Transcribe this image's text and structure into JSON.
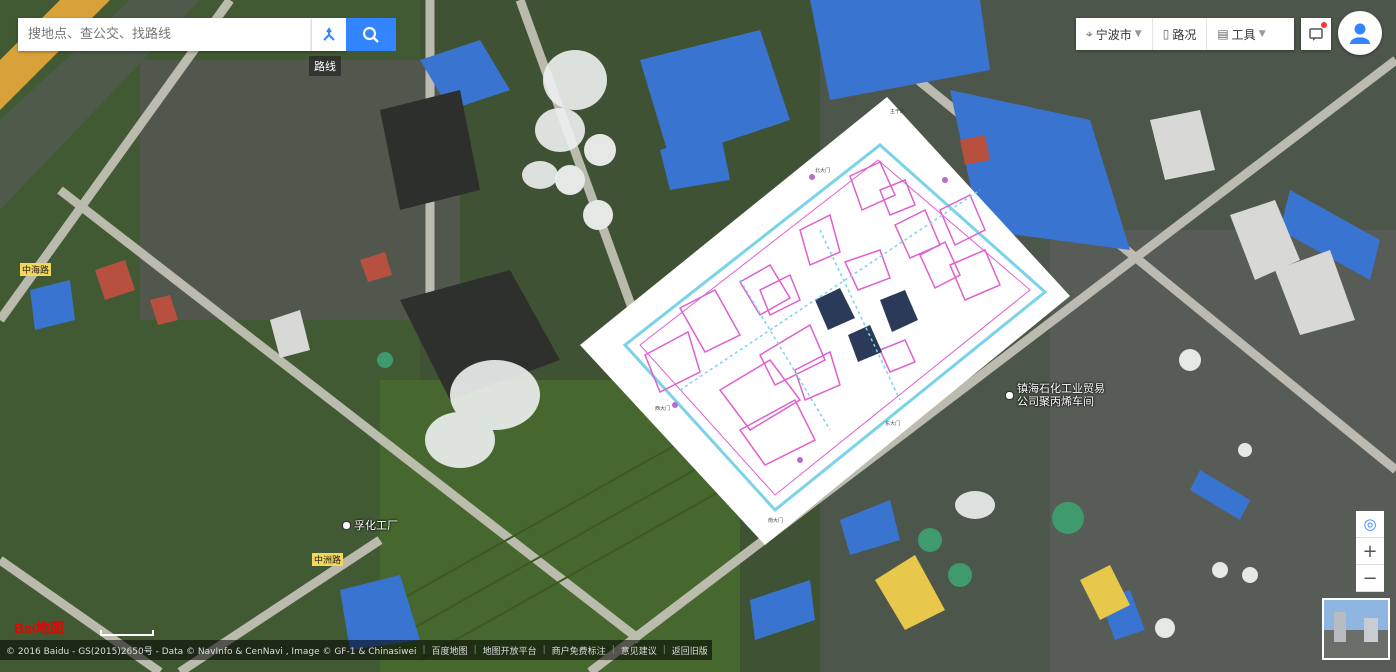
{
  "search": {
    "placeholder": "搜地点、查公交、找路线",
    "route_tip": "路线"
  },
  "toolbar": {
    "city": "宁波市",
    "traffic": "路况",
    "tools": "工具"
  },
  "map_labels": {
    "poi_1": "镇海石化工业贸易公司聚丙烯车间",
    "poi_2": "孚化工厂",
    "road_1": "中海路",
    "road_2": "中洲路"
  },
  "plan_labels": {
    "gate_north": "北大门",
    "gate_west": "西大门",
    "gate_east": "东大门",
    "gate_south": "南大门",
    "corner": "主干路"
  },
  "footer": {
    "copyright": "© 2016 Baidu - GS(2015)2650号 - Data © NavInfo & CenNavi , Image © GF-1 & Chinasiwei",
    "links": [
      "百度地图",
      "地图开放平台",
      "商户免费标注",
      "意见建议",
      "返回旧版"
    ]
  },
  "logo": {
    "text": "Bai地图"
  },
  "icons": {
    "route": "route-icon",
    "search": "search-icon",
    "city": "location-icon",
    "traffic": "traffic-icon",
    "tools": "toolbox-icon",
    "message": "message-icon",
    "user": "user-icon",
    "locate": "locate-icon",
    "zoom_in": "plus-icon",
    "zoom_out": "minus-icon"
  },
  "colors": {
    "brand": "#3385ff",
    "plan_outline": "#e05fcf",
    "plan_road": "#7ad3e8"
  }
}
